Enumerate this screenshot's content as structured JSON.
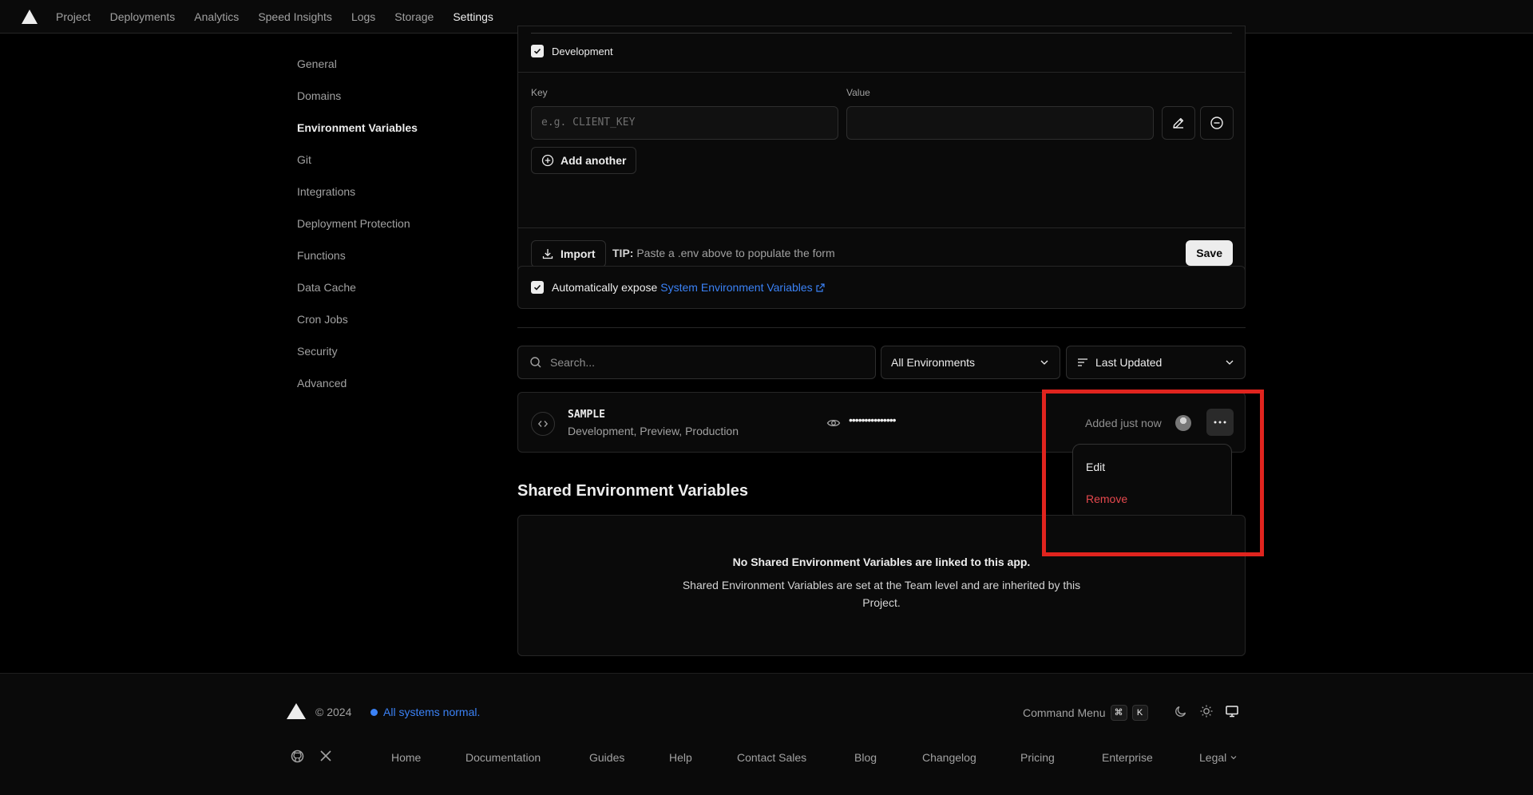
{
  "nav": {
    "tabs": [
      "Project",
      "Deployments",
      "Analytics",
      "Speed Insights",
      "Logs",
      "Storage",
      "Settings"
    ],
    "active": "Settings"
  },
  "sidebar": {
    "items": [
      "General",
      "Domains",
      "Environment Variables",
      "Git",
      "Integrations",
      "Deployment Protection",
      "Functions",
      "Data Cache",
      "Cron Jobs",
      "Security",
      "Advanced"
    ],
    "active": "Environment Variables"
  },
  "form": {
    "env_checkbox_label": "Development",
    "key_label": "Key",
    "value_label": "Value",
    "key_placeholder": "e.g. CLIENT_KEY",
    "value_value": "",
    "add_another_label": "Add another",
    "import_label": "Import",
    "tip_bold": "TIP:",
    "tip_text": "Paste a .env above to populate the form",
    "save_label": "Save"
  },
  "expose": {
    "text": "Automatically expose",
    "link": "System Environment Variables",
    "checked": true
  },
  "filters": {
    "search_placeholder": "Search...",
    "environment_select": "All Environments",
    "sort_select": "Last Updated"
  },
  "variable": {
    "name": "SAMPLE",
    "targets": "Development, Preview, Production",
    "masked_value": "•••••••••••••••",
    "added": "Added just now"
  },
  "menu": {
    "edit": "Edit",
    "remove": "Remove"
  },
  "shared": {
    "title": "Shared Environment Variables",
    "empty_heading": "No Shared Environment Variables are linked to this app.",
    "empty_body": "Shared Environment Variables are set at the Team level and are inherited by this Project."
  },
  "footer": {
    "copyright": "© 2024",
    "status": "All systems normal.",
    "command_menu": "Command Menu",
    "kbd1": "⌘",
    "kbd2": "K",
    "links": [
      "Home",
      "Documentation",
      "Guides",
      "Help",
      "Contact Sales",
      "Blog",
      "Changelog",
      "Pricing",
      "Enterprise",
      "Legal"
    ]
  },
  "colors": {
    "link_blue": "#3b82f6",
    "danger_red": "#e5484d",
    "highlight_red": "#e0241e"
  }
}
